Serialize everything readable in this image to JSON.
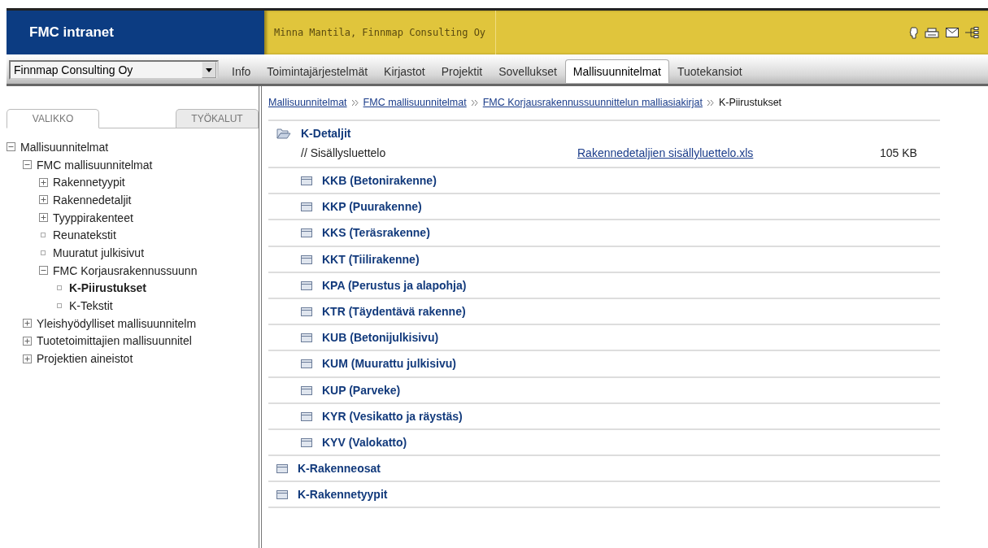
{
  "header": {
    "title": "FMC intranet",
    "user": "Minna Mantila, Finnmap Consulting Oy"
  },
  "company_select": {
    "value": "Finnmap Consulting Oy"
  },
  "nav_tabs": [
    {
      "label": "Info",
      "selected": false
    },
    {
      "label": "Toimintajärjestelmät",
      "selected": false
    },
    {
      "label": "Kirjastot",
      "selected": false
    },
    {
      "label": "Projektit",
      "selected": false
    },
    {
      "label": "Sovellukset",
      "selected": false
    },
    {
      "label": "Mallisuunnitelmat",
      "selected": true
    },
    {
      "label": "Tuotekansiot",
      "selected": false
    }
  ],
  "sidebar": {
    "tabs": [
      {
        "label": "VALIKKO",
        "selected": true
      },
      {
        "label": "TYÖKALUT",
        "selected": false
      }
    ],
    "tree": [
      {
        "label": "Mallisuunnitelmat",
        "kind": "folder",
        "expanded": true,
        "selected": false,
        "children": [
          {
            "label": "FMC mallisuunnitelmat",
            "kind": "folder",
            "expanded": true,
            "selected": false,
            "children": [
              {
                "label": "Rakennetyypit",
                "kind": "folder",
                "expanded": false,
                "selected": false
              },
              {
                "label": "Rakennedetaljit",
                "kind": "folder",
                "expanded": false,
                "selected": false
              },
              {
                "label": "Tyyppirakenteet",
                "kind": "folder",
                "expanded": false,
                "selected": false
              },
              {
                "label": "Reunatekstit",
                "kind": "page",
                "selected": false
              },
              {
                "label": "Muuratut julkisivut",
                "kind": "page",
                "selected": false
              },
              {
                "label": "FMC Korjausrakennussuunn",
                "kind": "folder",
                "expanded": true,
                "selected": false,
                "children": [
                  {
                    "label": "K-Piirustukset",
                    "kind": "page",
                    "selected": true
                  },
                  {
                    "label": "K-Tekstit",
                    "kind": "page",
                    "selected": false
                  }
                ]
              }
            ]
          },
          {
            "label": "Yleishyödylliset mallisuunnitelm",
            "kind": "folder",
            "expanded": false,
            "selected": false
          },
          {
            "label": "Tuotetoimittajien mallisuunnitel",
            "kind": "folder",
            "expanded": false,
            "selected": false
          },
          {
            "label": "Projektien aineistot",
            "kind": "folder",
            "expanded": false,
            "selected": false
          }
        ]
      }
    ]
  },
  "breadcrumb": [
    {
      "label": "Mallisuunnitelmat",
      "kind": "link"
    },
    {
      "label": "FMC mallisuunnitelmat",
      "kind": "link"
    },
    {
      "label": "FMC Korjausrakennussuunnittelun malliasiakirjat",
      "kind": "link"
    },
    {
      "label": "K-Piirustukset",
      "kind": "current"
    }
  ],
  "folders": [
    {
      "label": "K-Detaljit",
      "expanded": true,
      "files": [
        {
          "label": "// Sisällysluettelo",
          "link": "Rakennedetaljien sisällyluettelo.xls",
          "size": "105 KB"
        }
      ],
      "children": [
        {
          "label": "KKB (Betonirakenne)",
          "expanded": false
        },
        {
          "label": "KKP (Puurakenne)",
          "expanded": false
        },
        {
          "label": "KKS (Teräsrakenne)",
          "expanded": false
        },
        {
          "label": "KKT (Tiilirakenne)",
          "expanded": false
        },
        {
          "label": "KPA (Perustus ja alapohja)",
          "expanded": false
        },
        {
          "label": "KTR (Täydentävä rakenne)",
          "expanded": false
        },
        {
          "label": "KUB (Betonijulkisivu)",
          "expanded": false
        },
        {
          "label": "KUM (Muurattu julkisivu)",
          "expanded": false
        },
        {
          "label": "KUP (Parveke)",
          "expanded": false
        },
        {
          "label": "KYR (Vesikatto ja räystäs)",
          "expanded": false
        },
        {
          "label": "KYV (Valokatto)",
          "expanded": false
        }
      ]
    },
    {
      "label": "K-Rakenneosat",
      "expanded": false
    },
    {
      "label": "K-Rakennetyypit",
      "expanded": false
    }
  ]
}
